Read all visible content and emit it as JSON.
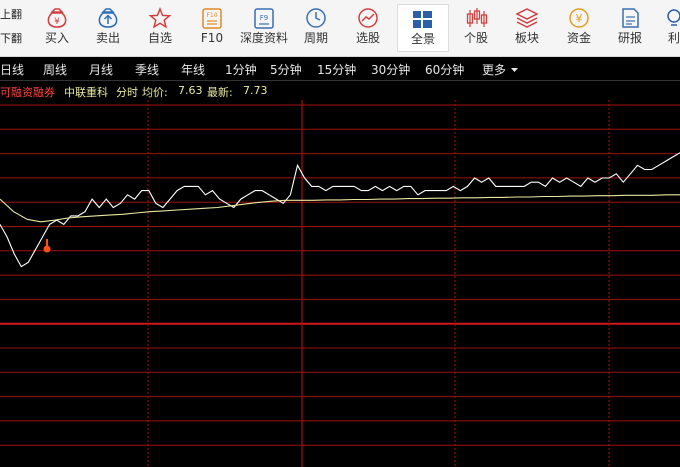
{
  "pager": {
    "prev": "上翻",
    "next": "下翻"
  },
  "toolbar": [
    {
      "label": "买入",
      "icon": "money-bag-icon",
      "color": "#d04040"
    },
    {
      "label": "卖出",
      "icon": "money-bag-up-icon",
      "color": "#2d6fb8"
    },
    {
      "label": "自选",
      "icon": "star-icon",
      "color": "#d04040"
    },
    {
      "label": "F10",
      "icon": "f10-icon",
      "color": "#e08a2a"
    },
    {
      "label": "深度资料",
      "icon": "f9-icon",
      "color": "#3a6fb0"
    },
    {
      "label": "周期",
      "icon": "clock-icon",
      "color": "#3a6fb0"
    },
    {
      "label": "选股",
      "icon": "select-stock-icon",
      "color": "#d04040"
    },
    {
      "label": "全景",
      "icon": "panorama-icon",
      "color": "#2b5fa8",
      "active": true
    },
    {
      "label": "个股",
      "icon": "candlestick-icon",
      "color": "#d04040"
    },
    {
      "label": "板块",
      "icon": "layers-icon",
      "color": "#d04040"
    },
    {
      "label": "资金",
      "icon": "yen-coin-icon",
      "color": "#e0a020"
    },
    {
      "label": "研报",
      "icon": "report-icon",
      "color": "#3a6fb0"
    },
    {
      "label": "利",
      "icon": "lightbulb-icon",
      "color": "#2b5fa8"
    }
  ],
  "periods": [
    "日线",
    "周线",
    "月线",
    "季线",
    "年线",
    "1分钟",
    "5分钟",
    "15分钟",
    "30分钟",
    "60分钟",
    "更多"
  ],
  "info": {
    "margin_tag": "可融资融券",
    "stock_name": "中联重科",
    "mode": "分时",
    "avg_label": "均价:",
    "avg_value": "7.63",
    "latest_label": "最新:",
    "latest_value": "7.73"
  },
  "colors": {
    "grid": "#a01010",
    "price_line": "#ffffff",
    "avg_line": "#e8e8a0",
    "margin_tag": "#ff4040",
    "info_text": "#e8e8a0",
    "marker": "#ff5010"
  },
  "chart_data": {
    "type": "line",
    "series": [
      {
        "values": [
          7.56,
          7.53,
          7.49,
          7.46,
          7.47,
          7.5,
          7.53,
          7.56,
          7.57,
          7.56,
          7.58,
          7.58,
          7.59,
          7.62,
          7.6,
          7.62,
          7.6,
          7.61,
          7.63,
          7.62,
          7.64,
          7.64,
          7.61,
          7.6,
          7.62,
          7.64,
          7.65,
          7.65,
          7.65,
          7.63,
          7.64,
          7.62,
          7.61,
          7.6,
          7.62,
          7.63,
          7.64,
          7.64,
          7.63,
          7.62,
          7.61,
          7.63,
          7.7,
          7.67,
          7.65,
          7.65,
          7.64,
          7.65,
          7.65,
          7.65,
          7.65,
          7.64,
          7.64,
          7.65,
          7.64,
          7.65,
          7.64,
          7.65,
          7.65,
          7.63,
          7.64,
          7.64,
          7.64,
          7.64,
          7.65,
          7.64,
          7.65,
          7.67,
          7.66,
          7.67,
          7.65,
          7.65,
          7.65,
          7.65,
          7.65,
          7.66,
          7.66,
          7.65,
          7.67,
          7.66,
          7.67,
          7.66,
          7.65,
          7.67,
          7.66,
          7.67,
          7.67,
          7.68,
          7.66,
          7.68,
          7.7,
          7.69,
          7.69,
          7.7,
          7.71,
          7.72,
          7.73
        ]
      },
      {
        "values": [
          7.62,
          7.59,
          7.572,
          7.566,
          7.57,
          7.575,
          7.578,
          7.58,
          7.582,
          7.584,
          7.587,
          7.59,
          7.592,
          7.594,
          7.596,
          7.598,
          7.6,
          7.604,
          7.608,
          7.612,
          7.615,
          7.617,
          7.617,
          7.617,
          7.618,
          7.618,
          7.619,
          7.619,
          7.62,
          7.62,
          7.621,
          7.621,
          7.622,
          7.622,
          7.623,
          7.623,
          7.624,
          7.624,
          7.625,
          7.625,
          7.626,
          7.626,
          7.627,
          7.627,
          7.628,
          7.628,
          7.629,
          7.629,
          7.629,
          7.63,
          7.63
        ]
      }
    ],
    "ylim": [
      7.44,
      7.76
    ],
    "grid": true
  }
}
